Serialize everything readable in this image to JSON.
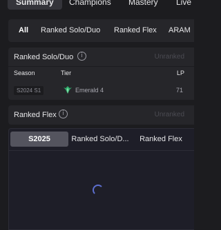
{
  "top_nav": {
    "tabs": [
      {
        "label": "Summary"
      },
      {
        "label": "Champions"
      },
      {
        "label": "Mastery"
      },
      {
        "label": "Live G"
      }
    ]
  },
  "queue_filter": {
    "tabs": [
      {
        "label": "All"
      },
      {
        "label": "Ranked Solo/Duo"
      },
      {
        "label": "Ranked Flex"
      },
      {
        "label": "ARAM"
      }
    ]
  },
  "solo_card": {
    "title": "Ranked Solo/Duo",
    "info_icon": "i",
    "status": "Unranked",
    "columns": {
      "season": "Season",
      "tier": "Tier",
      "lp": "LP"
    },
    "row": {
      "season": "S2024 S1",
      "tier_icon": "emerald-crest-icon",
      "tier": "Emerald 4",
      "lp": "71",
      "tier_color": "#2faa6a"
    }
  },
  "flex_card": {
    "title": "Ranked Flex",
    "info_icon": "i",
    "status": "Unranked"
  },
  "champion_panel": {
    "tabs": [
      {
        "label": "S2025"
      },
      {
        "label": "Ranked Solo/D..."
      },
      {
        "label": "Ranked Flex"
      }
    ],
    "loading": true,
    "accent": "#5d6fd0"
  }
}
